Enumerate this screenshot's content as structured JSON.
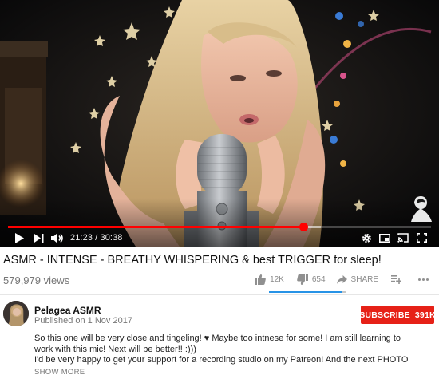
{
  "player": {
    "current_time": "21:23",
    "duration": "30:38",
    "time_separator": " / ",
    "played_fraction": 0.698,
    "buffered_fraction": 0.74
  },
  "video": {
    "title": "ASMR - INTENSE - BREATHY WHISPERING & best TRIGGER for sleep!",
    "views": "579,979 views"
  },
  "actions": {
    "like_count": "12K",
    "dislike_count": "654",
    "share_label": "SHARE",
    "like_fraction": 0.95
  },
  "channel": {
    "name": "Pelagea ASMR",
    "published": "Published on 1 Nov 2017",
    "subscribe_label": "SUBSCRIBE",
    "subscriber_count": "391K"
  },
  "description": {
    "lines": [
      "So this one will be very close and tingeling! ♥ Maybe too intnese for some! I am still learning to",
      "work with this mic! Next will be better!! :)))",
      "I'd be very happy to get your support for a recording studio on my Patreon! And the next PHOTO"
    ],
    "show_more_label": "SHOW MORE"
  },
  "colors": {
    "accent": "#ff0000",
    "subscribe": "#e62117",
    "like_bar": "#2793e6"
  },
  "icons": [
    "play-icon",
    "next-icon",
    "volume-icon",
    "settings-icon",
    "miniplayer-icon",
    "cast-icon",
    "fullscreen-icon",
    "thumbs-up-icon",
    "thumbs-down-icon",
    "share-icon",
    "add-to-playlist-icon",
    "more-icon"
  ]
}
